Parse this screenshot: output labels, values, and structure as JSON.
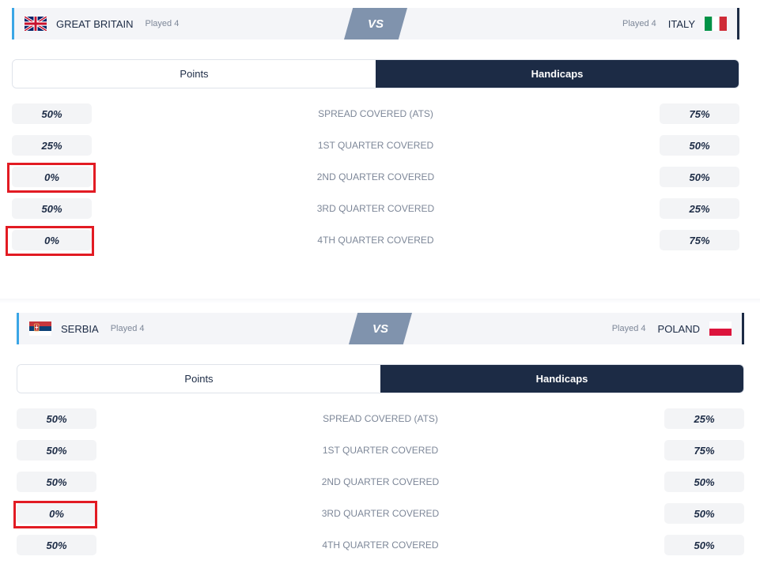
{
  "colors": {
    "navy": "#1c2b45",
    "accent_blue": "#3aa6e6",
    "vs_gray": "#8093ad",
    "highlight_red": "#e21b23",
    "muted_text": "#7d8798"
  },
  "matches": [
    {
      "home": {
        "name": "GREAT BRITAIN",
        "played": "Played 4",
        "flag": "united-kingdom-flag-icon"
      },
      "away": {
        "name": "ITALY",
        "played": "Played 4",
        "flag": "italy-flag-icon"
      },
      "vs": "VS",
      "tabs": [
        {
          "label": "Points",
          "active": false
        },
        {
          "label": "Handicaps",
          "active": true
        }
      ],
      "rows": [
        {
          "label": "SPREAD COVERED (ATS)",
          "home": "50%",
          "away": "75%"
        },
        {
          "label": "1ST QUARTER COVERED",
          "home": "25%",
          "away": "50%"
        },
        {
          "label": "2ND QUARTER COVERED",
          "home": "0%",
          "away": "50%"
        },
        {
          "label": "3RD QUARTER COVERED",
          "home": "50%",
          "away": "25%"
        },
        {
          "label": "4TH QUARTER COVERED",
          "home": "0%",
          "away": "75%"
        }
      ]
    },
    {
      "home": {
        "name": "SERBIA",
        "played": "Played 4",
        "flag": "serbia-flag-icon"
      },
      "away": {
        "name": "POLAND",
        "played": "Played 4",
        "flag": "poland-flag-icon"
      },
      "vs": "VS",
      "tabs": [
        {
          "label": "Points",
          "active": false
        },
        {
          "label": "Handicaps",
          "active": true
        }
      ],
      "rows": [
        {
          "label": "SPREAD COVERED (ATS)",
          "home": "50%",
          "away": "25%"
        },
        {
          "label": "1ST QUARTER COVERED",
          "home": "50%",
          "away": "75%"
        },
        {
          "label": "2ND QUARTER COVERED",
          "home": "50%",
          "away": "50%"
        },
        {
          "label": "3RD QUARTER COVERED",
          "home": "0%",
          "away": "50%"
        },
        {
          "label": "4TH QUARTER COVERED",
          "home": "50%",
          "away": "50%"
        }
      ]
    }
  ]
}
